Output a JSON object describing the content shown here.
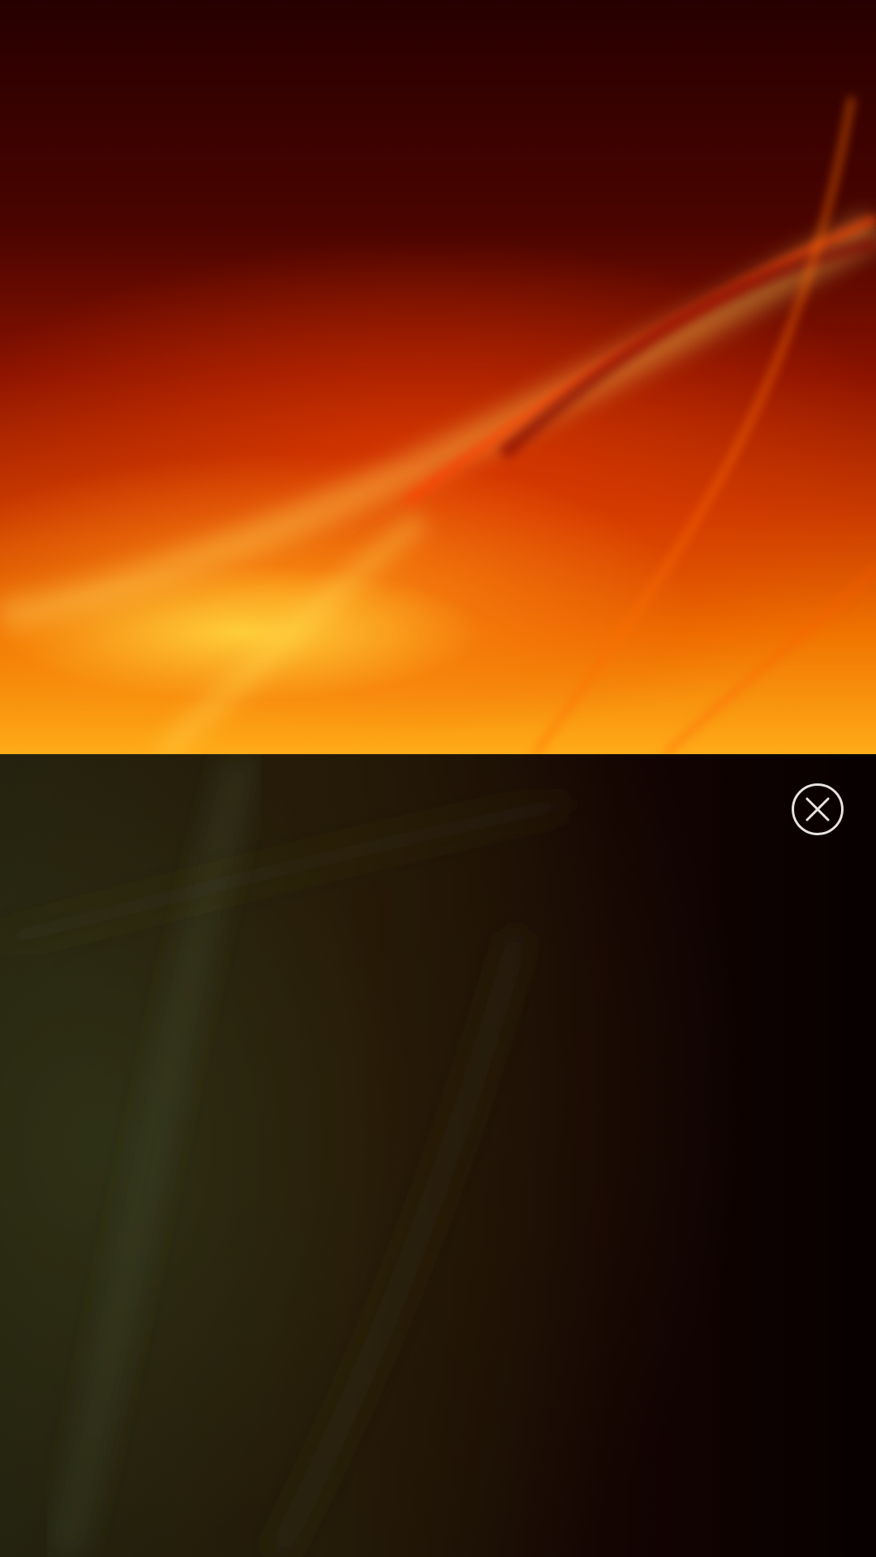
{
  "overlay": {
    "close_icon": "close-circle-icon",
    "close_color": "#e8e2e2"
  },
  "wallpaper": {
    "top_colors": [
      "#260000",
      "#8a1200",
      "#f07400",
      "#ffab18"
    ],
    "bottom_colors": [
      "#23230f",
      "#140402",
      "#070000"
    ]
  }
}
